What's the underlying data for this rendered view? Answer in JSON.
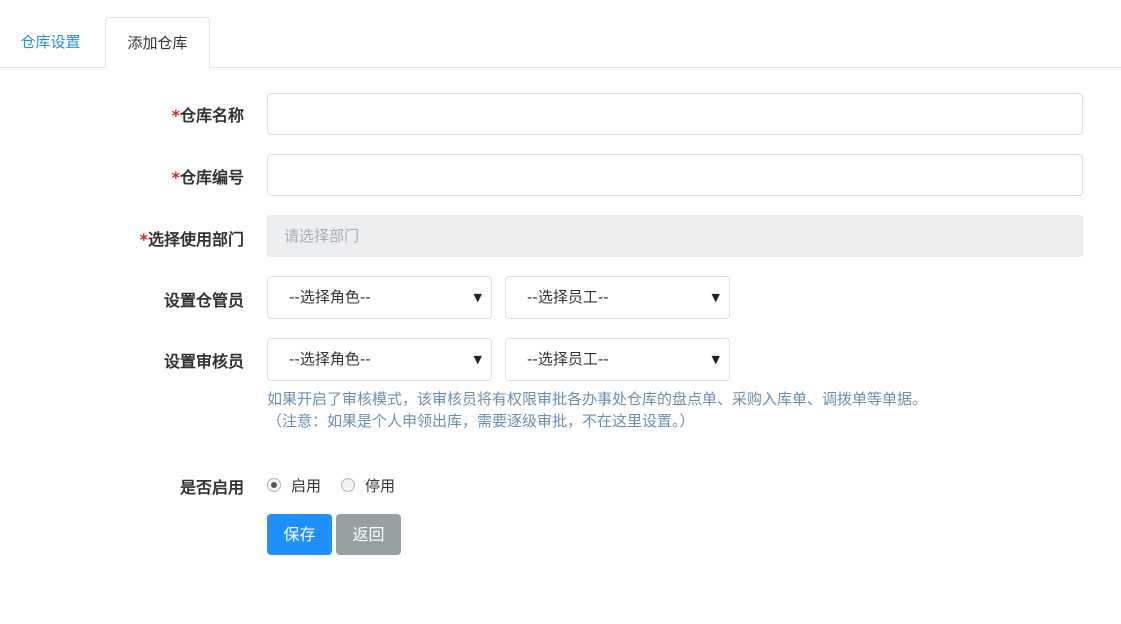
{
  "tabs": [
    {
      "label": "仓库设置"
    },
    {
      "label": "添加仓库"
    }
  ],
  "form": {
    "required_mark": "*",
    "warehouse_name": {
      "label": "仓库名称",
      "value": ""
    },
    "warehouse_code": {
      "label": "仓库编号",
      "value": ""
    },
    "department": {
      "label": "选择使用部门",
      "placeholder": "请选择部门"
    },
    "keeper": {
      "label": "设置仓管员",
      "role_select": "--选择角色--",
      "staff_select": "--选择员工--"
    },
    "auditor": {
      "label": "设置审核员",
      "role_select": "--选择角色--",
      "staff_select": "--选择员工--"
    },
    "hint_line1": "如果开启了审核模式，该审核员将有权限审批各办事处仓库的盘点单、采购入库单、调拨单等单据。",
    "hint_line2": "（注意：如果是个人申领出库，需要逐级审批，不在这里设置。）",
    "enabled": {
      "label": "是否启用",
      "options": [
        "启用",
        "停用"
      ],
      "selected": "启用"
    }
  },
  "buttons": {
    "save": "保存",
    "back": "返回"
  },
  "icons": {
    "select_arrow": "▼"
  },
  "colors": {
    "tab_active": "#2b8fd6",
    "required": "#e02020",
    "save_button": "#1e90ff",
    "back_button": "#97a0a0",
    "hint": "#6c8fae"
  }
}
